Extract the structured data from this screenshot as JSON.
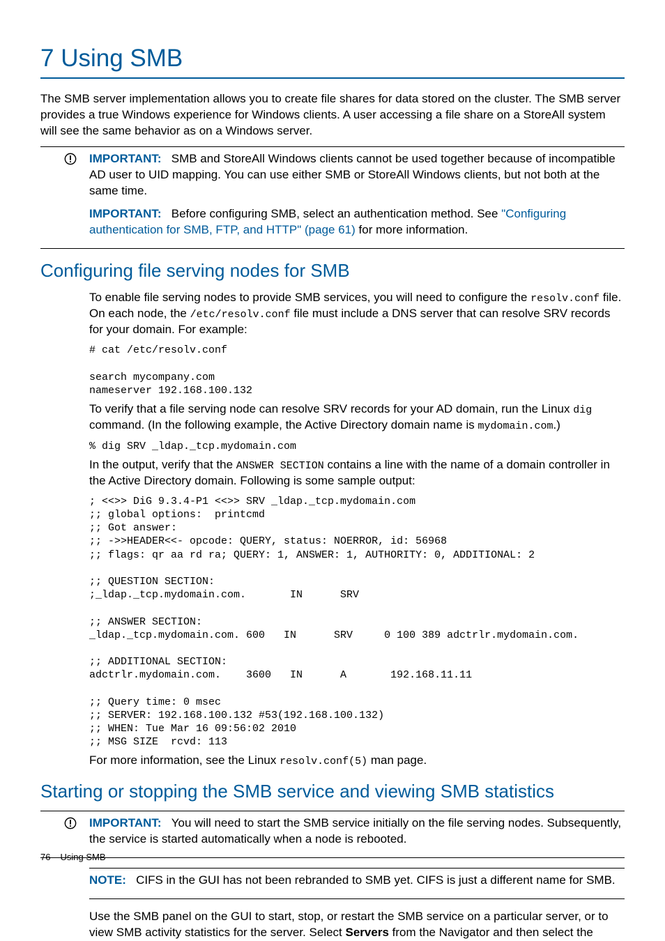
{
  "title": "7 Using SMB",
  "intro": "The SMB server implementation allows you to create file shares for data stored on the cluster. The SMB server provides a true Windows experience for Windows clients. A user accessing a file share on a StoreAll system will see the same behavior as on a Windows server.",
  "important1_label": "IMPORTANT:",
  "important1_text": "SMB and StoreAll Windows clients cannot be used together because of incompatible AD user to UID mapping. You can use either SMB or StoreAll Windows clients, but not both at the same time.",
  "important2_label": "IMPORTANT:",
  "important2_text_pre": "Before configuring SMB, select an authentication method. See ",
  "important2_link": "\"Configuring authentication for SMB, FTP, and HTTP\" (page 61)",
  "important2_text_post": " for more information.",
  "section1_title": "Configuring file serving nodes for SMB",
  "s1_p1_a": "To enable file serving nodes to provide SMB services, you will need to configure the ",
  "s1_p1_code1": "resolv.conf",
  "s1_p1_b": " file. On each node, the ",
  "s1_p1_code2": "/etc/resolv.conf",
  "s1_p1_c": " file must include a DNS server that can resolve SRV records for your domain. For example:",
  "s1_code1": "# cat /etc/resolv.conf\n\nsearch mycompany.com\nnameserver 192.168.100.132",
  "s1_p2_a": "To verify that a file serving node can resolve SRV records for your AD domain, run the Linux ",
  "s1_p2_code1": "dig",
  "s1_p2_b": " command. (In the following example, the Active Directory domain name is ",
  "s1_p2_code2": "mydomain.com",
  "s1_p2_c": ".)",
  "s1_code2": "% dig SRV _ldap._tcp.mydomain.com",
  "s1_p3_a": "In the output, verify that the ",
  "s1_p3_code1": "ANSWER SECTION",
  "s1_p3_b": " contains a line with the name of a domain controller in the Active Directory domain. Following is some sample output:",
  "s1_code3": "; <<>> DiG 9.3.4-P1 <<>> SRV _ldap._tcp.mydomain.com\n;; global options:  printcmd\n;; Got answer:\n;; ->>HEADER<<- opcode: QUERY, status: NOERROR, id: 56968\n;; flags: qr aa rd ra; QUERY: 1, ANSWER: 1, AUTHORITY: 0, ADDITIONAL: 2\n\n;; QUESTION SECTION:\n;_ldap._tcp.mydomain.com.       IN      SRV\n\n;; ANSWER SECTION:\n_ldap._tcp.mydomain.com. 600   IN      SRV     0 100 389 adctrlr.mydomain.com.\n\n;; ADDITIONAL SECTION:\nadctrlr.mydomain.com.    3600   IN      A       192.168.11.11\n\n;; Query time: 0 msec\n;; SERVER: 192.168.100.132 #53(192.168.100.132)\n;; WHEN: Tue Mar 16 09:56:02 2010\n;; MSG SIZE  rcvd: 113",
  "s1_p4_a": "For more information, see the Linux ",
  "s1_p4_code1": "resolv.conf(5)",
  "s1_p4_b": " man page.",
  "section2_title": "Starting or stopping the SMB service and viewing SMB statistics",
  "important3_label": "IMPORTANT:",
  "important3_text": "You will need to start the SMB service initially on the file serving nodes. Subsequently, the service is started automatically when a node is rebooted.",
  "note_label": "NOTE:",
  "note_text": "CIFS in the GUI has not been rebranded to SMB yet. CIFS is just a different name for SMB.",
  "s2_p1_a": "Use the SMB panel on the GUI to start, stop, or restart the SMB service on a particular server, or to view SMB activity statistics for the server. Select ",
  "s2_p1_bold": "Servers",
  "s2_p1_b": " from the Navigator and then select the",
  "footer_page": "76",
  "footer_text": "Using SMB"
}
